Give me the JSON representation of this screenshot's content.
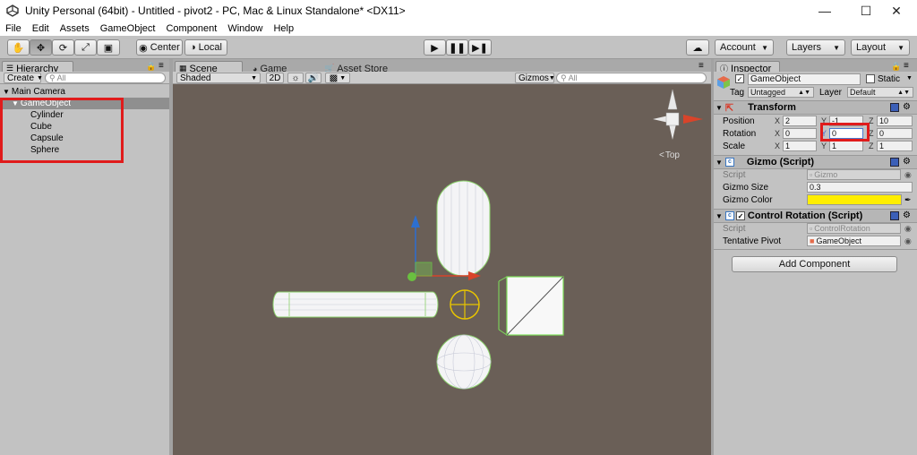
{
  "window": {
    "title": "Unity Personal (64bit) - Untitled - pivot2 - PC, Mac & Linux Standalone* <DX11>"
  },
  "menu": [
    "File",
    "Edit",
    "Assets",
    "GameObject",
    "Component",
    "Window",
    "Help"
  ],
  "toolbar": {
    "pivot_label": "Center",
    "space_label": "Local",
    "account_label": "Account",
    "layers_label": "Layers",
    "layout_label": "Layout"
  },
  "hierarchy": {
    "tab": "Hierarchy",
    "create_label": "Create",
    "search_placeholder": "All",
    "items": [
      {
        "label": "Main Camera"
      },
      {
        "label": "GameObject"
      },
      {
        "label": "Cylinder"
      },
      {
        "label": "Cube"
      },
      {
        "label": "Capsule"
      },
      {
        "label": "Sphere"
      }
    ]
  },
  "scene": {
    "tabs": [
      "Scene",
      "Game",
      "Asset Store"
    ],
    "shading": "Shaded",
    "mode_2d": "2D",
    "gizmos_label": "Gizmos",
    "search_placeholder": "All",
    "view_label": "Top"
  },
  "inspector": {
    "tab": "Inspector",
    "object_name": "GameObject",
    "static_label": "Static",
    "tag_label": "Tag",
    "tag_value": "Untagged",
    "layer_label": "Layer",
    "layer_value": "Default",
    "transform": {
      "title": "Transform",
      "position_label": "Position",
      "rotation_label": "Rotation",
      "scale_label": "Scale",
      "position": {
        "x": "2",
        "y": "-1",
        "z": "10"
      },
      "rotation": {
        "x": "0",
        "y": "0",
        "z": "0"
      },
      "scale": {
        "x": "1",
        "y": "1",
        "z": "1"
      }
    },
    "gizmo": {
      "title": "Gizmo (Script)",
      "script_label": "Script",
      "script_value": "Gizmo",
      "size_label": "Gizmo Size",
      "size_value": "0.3",
      "color_label": "Gizmo Color",
      "color_value": "#ffee00"
    },
    "control_rotation": {
      "title": "Control Rotation (Script)",
      "script_label": "Script",
      "script_value": "ControlRotation",
      "pivot_label": "Tentative Pivot",
      "pivot_value": "GameObject"
    },
    "add_component_label": "Add Component"
  },
  "axes": {
    "x": "X",
    "y": "Y",
    "z": "Z"
  },
  "colors": {
    "highlight": "#e01b1b",
    "wire": "#7ee05a",
    "gizmo_yellow": "#e8c400"
  }
}
